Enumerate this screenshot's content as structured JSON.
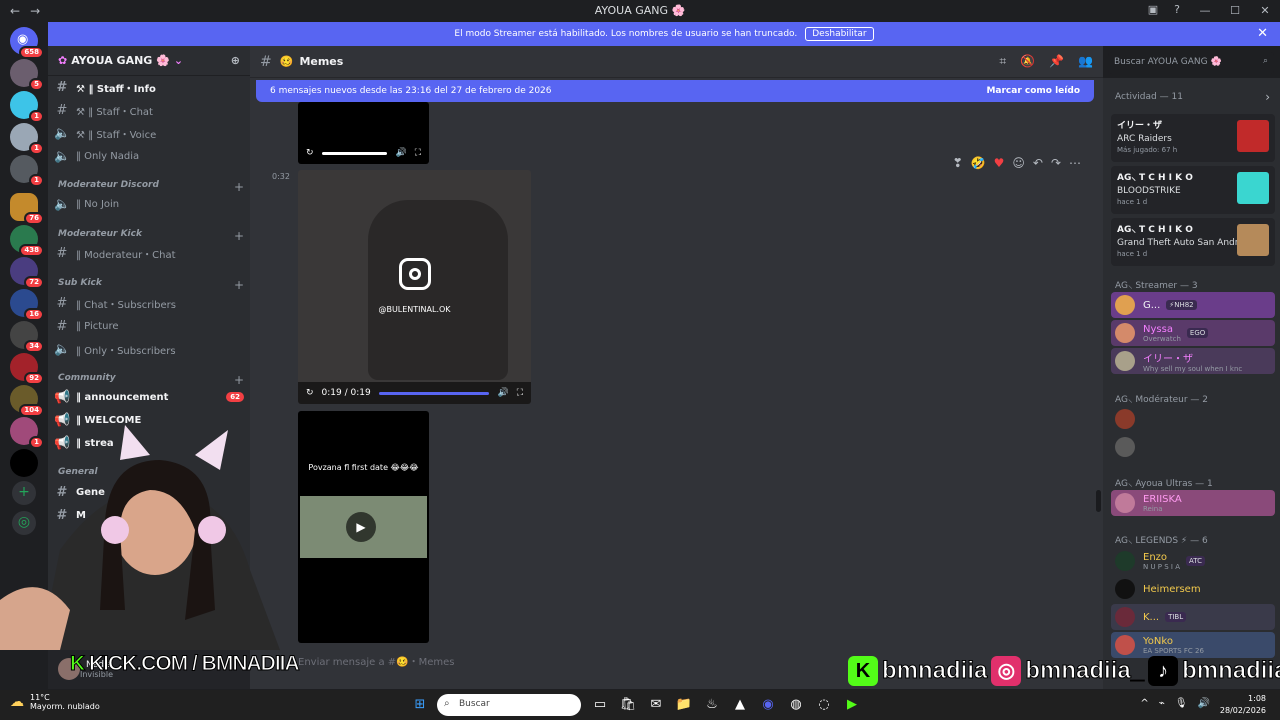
{
  "titlebar": {
    "back": "←",
    "forward": "→",
    "title": "AYOUA GANG 🌸",
    "minimize": "—",
    "maximize": "☐",
    "close": "✕"
  },
  "banner": {
    "text": "El modo Streamer está habilitado. Los nombres de usuario se han truncado.",
    "button": "Deshabilitar"
  },
  "rail": {
    "badges": [
      "658",
      "5",
      "1",
      "1",
      "1",
      "76",
      "438",
      "72",
      "16",
      "34",
      "92",
      "104",
      "1"
    ]
  },
  "server": {
    "name": "AYOUA GANG",
    "channels": [
      {
        "label": "⚒ ‖ Staff・Info",
        "unread": true
      },
      {
        "label": "⚒ ‖ Staff・Chat"
      },
      {
        "label": "⚒ ‖ Staff・Voice"
      },
      {
        "label": "‖ Only Nadia"
      },
      {
        "label": "‖ No Join"
      },
      {
        "label": "‖ Moderateur・Chat"
      },
      {
        "label": "‖ Chat・Subscribers"
      },
      {
        "label": "‖ Picture"
      },
      {
        "label": "‖ Only・Subscribers"
      },
      {
        "label": "‖ announcement",
        "unread": true,
        "count": "62"
      },
      {
        "label": "‖ WELCOME",
        "unread": true
      },
      {
        "label": "‖ strea",
        "unread": true
      },
      {
        "label": "Gene",
        "unread": true
      },
      {
        "label": "M",
        "unread": true
      }
    ],
    "categories": [
      "Moderateur Discord",
      "Moderateur Kick",
      "Sub Kick",
      "Community",
      "General"
    ]
  },
  "user": {
    "name": "Nadia",
    "status": "Invisible"
  },
  "chat": {
    "channel": "Memes",
    "new_messages": "6 mensajes nuevos desde las 23:16 del 27 de febrero de 2026",
    "mark_read": "Marcar como leído",
    "msg_time": "0:32",
    "video_time": "0:19 / 0:19",
    "video_watermark": "@BULENTINAL.OK",
    "caption": "Povzana fl first date 😂😂😂",
    "composer_placeholder": "Enviar mensaje a #🥴・Memes"
  },
  "search": {
    "placeholder": "Buscar AYOUA GANG 🌸"
  },
  "members": {
    "activity_header": "Actividad — 11",
    "activities": [
      {
        "user": "イリー・ザ",
        "game": "ARC Raiders",
        "meta": "Más jugado: 67 h",
        "color": "#c12a2a"
      },
      {
        "user": "AG⸜ T C H I K O",
        "game": "BLOODSTRIKE",
        "meta": "hace 1 d",
        "color": "#3ad6d0"
      },
      {
        "user": "AG⸜ T C H I K O",
        "game": "Grand Theft Auto San Andr...",
        "meta": "hace 1 d",
        "color": "#b58a5a"
      }
    ],
    "groups": [
      {
        "title": "AG⸜ Streamer — 3",
        "items": [
          {
            "name": "G...",
            "tag": "⚡NH82",
            "sub": ""
          },
          {
            "name": "Nyssa",
            "tag": "EGO",
            "sub": "Overwatch"
          },
          {
            "name": "イリー・ザ",
            "tag": "",
            "sub": "Why sell my soul when I knc"
          }
        ]
      },
      {
        "title": "AG⸜ Modérateur — 2",
        "items": [
          {
            "name": "",
            "tag": "",
            "sub": ""
          },
          {
            "name": "",
            "tag": "",
            "sub": ""
          }
        ]
      },
      {
        "title": "AG⸜ Ayoua Ultras — 1",
        "items": [
          {
            "name": "ERIISKA",
            "tag": "",
            "sub": "Reina"
          }
        ]
      },
      {
        "title": "AG⸜ LEGENDS ⚡ — 6",
        "items": [
          {
            "name": "Enzo",
            "tag": "ATC",
            "sub": "N U P S I A"
          },
          {
            "name": "Heimersem",
            "tag": "",
            "sub": ""
          },
          {
            "name": "K...",
            "tag": "TIBL",
            "sub": ""
          },
          {
            "name": "YoNko",
            "tag": "",
            "sub": "EA SPORTS FC 26"
          }
        ]
      }
    ]
  },
  "overlay": {
    "kick": "KICK.COM / BMNADIIA",
    "handles": [
      "bmnadiia",
      "bmnadiia_",
      "bmnadiia"
    ]
  },
  "taskbar": {
    "temp": "11°C",
    "weather": "Mayorm. nublado",
    "search": "Buscar",
    "time": "1:08",
    "date": "28/02/2026"
  }
}
